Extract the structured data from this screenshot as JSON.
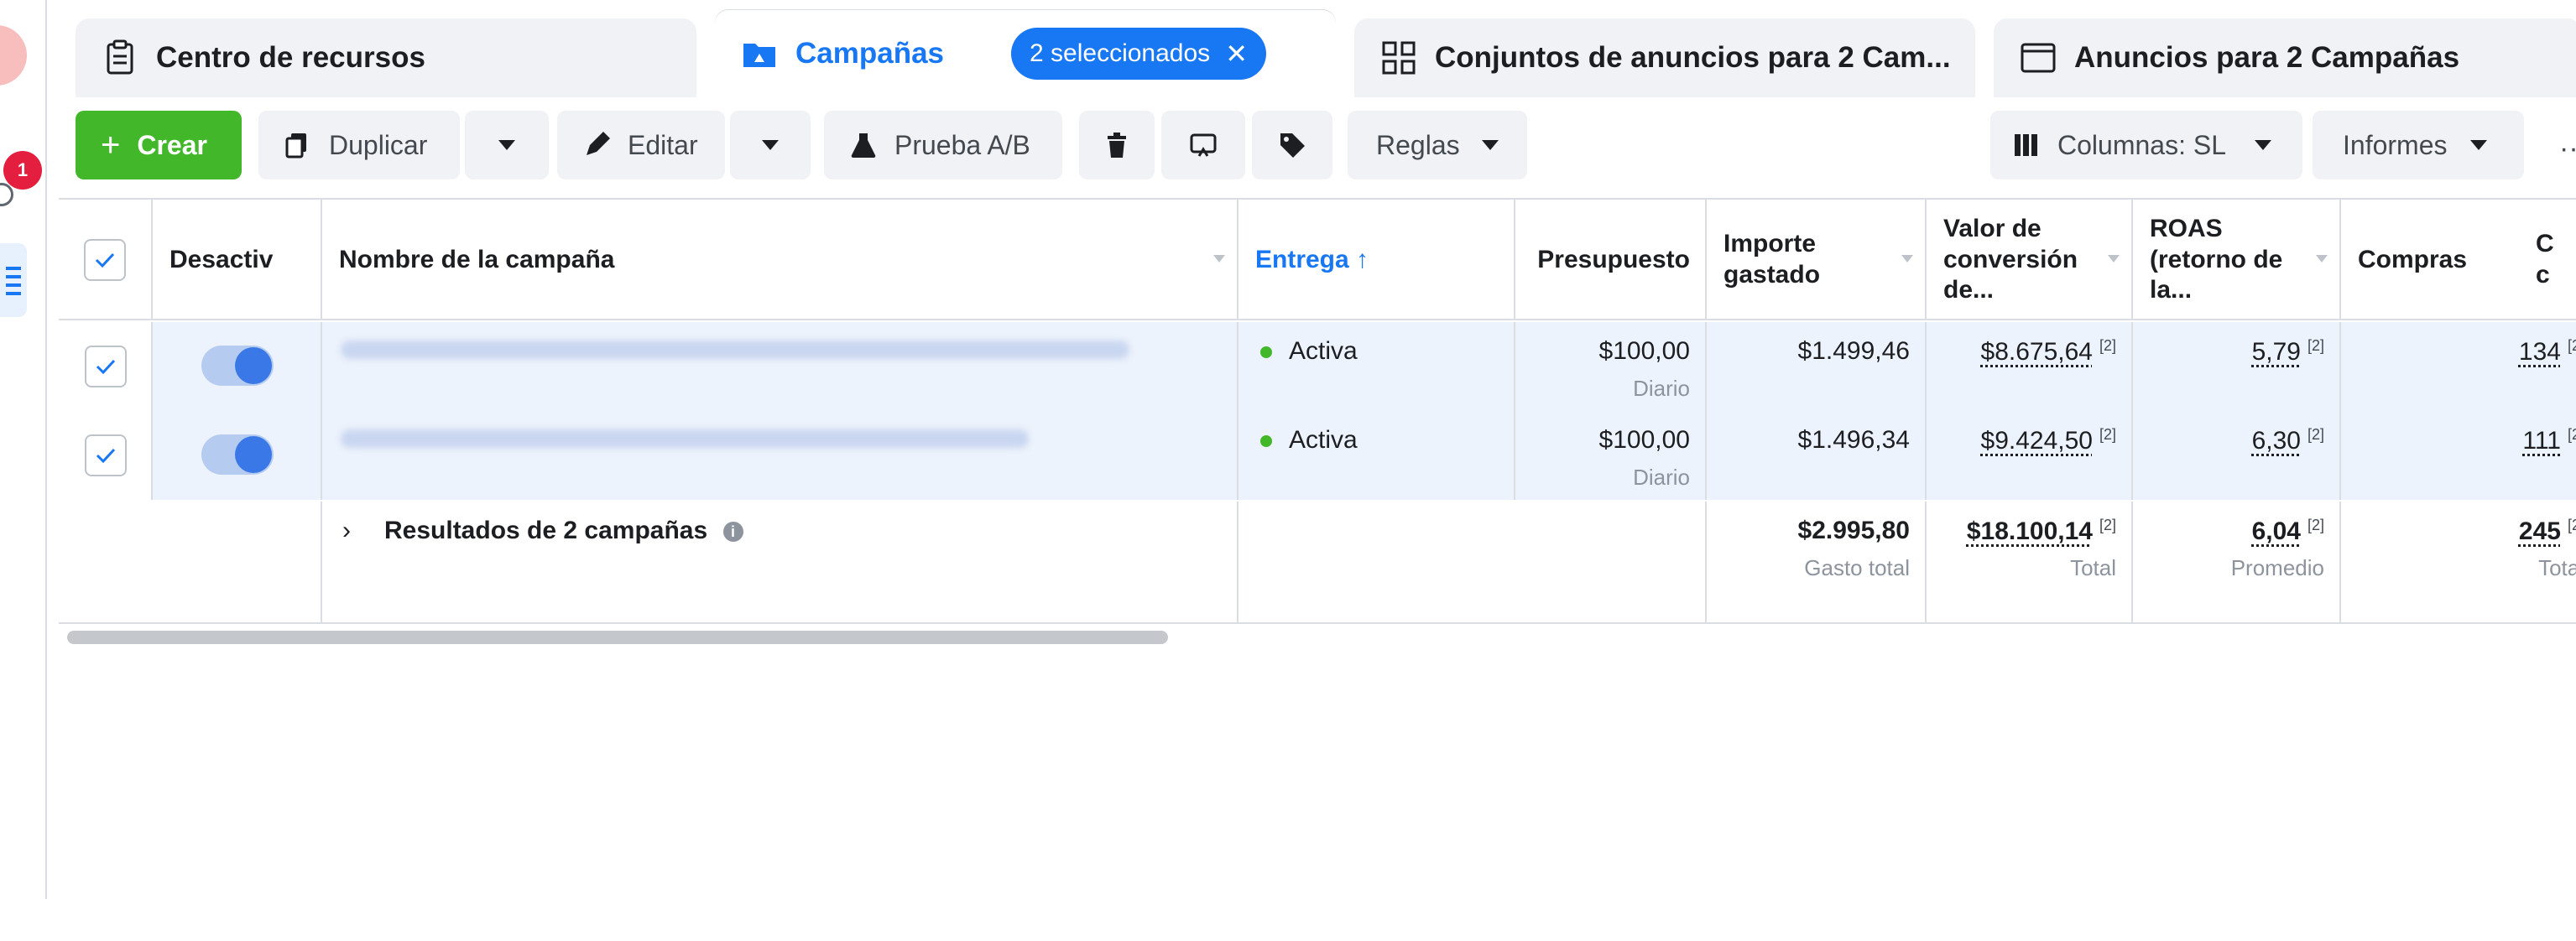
{
  "left_rail": {
    "notification_count": "1"
  },
  "tabs": [
    {
      "label": "Centro de recursos",
      "icon": "clipboard-icon"
    },
    {
      "label": "Campañas",
      "icon": "folder-icon",
      "selected_pill": "2 seleccionados"
    },
    {
      "label": "Conjuntos de anuncios para 2 Cam...",
      "icon": "grid-icon"
    },
    {
      "label": "Anuncios para 2 Campañas",
      "icon": "ad-frame-icon"
    }
  ],
  "toolbar": {
    "create": "Crear",
    "duplicate": "Duplicar",
    "edit": "Editar",
    "ab_test": "Prueba A/B",
    "rules": "Reglas",
    "columns": "Columnas: SL",
    "reports": "Informes"
  },
  "table": {
    "headers": {
      "off": "Desactiv",
      "name": "Nombre de la campaña",
      "delivery": "Entrega ↑",
      "budget": "Presupuesto",
      "spent_1": "Importe",
      "spent_2": "gastado",
      "conv_1": "Valor de",
      "conv_2": "conversión",
      "conv_3": "de...",
      "roas_1": "ROAS",
      "roas_2": "(retorno de",
      "roas_3": "la...",
      "purchases": "Compras",
      "extra_1": "C",
      "extra_2": "c"
    },
    "rows": [
      {
        "delivery": "Activa",
        "budget": "$100,00",
        "budget_sub": "Diario",
        "spent": "$1.499,46",
        "conv": "$8.675,64",
        "roas": "5,79",
        "purchases": "134",
        "footnote": "[2]"
      },
      {
        "delivery": "Activa",
        "budget": "$100,00",
        "budget_sub": "Diario",
        "spent": "$1.496,34",
        "conv": "$9.424,50",
        "roas": "6,30",
        "purchases": "111",
        "footnote": "[2]"
      }
    ],
    "totals": {
      "label": "Resultados de 2 campañas",
      "spent": "$2.995,80",
      "spent_sub": "Gasto total",
      "conv": "$18.100,14",
      "conv_sub": "Total",
      "roas": "6,04",
      "roas_sub": "Promedio",
      "purchases": "245",
      "purchases_sub": "Total",
      "footnote": "[2]"
    }
  },
  "colors": {
    "accent": "#1877f2",
    "create": "#42b72a",
    "selected_row": "#edf3fc",
    "badge": "#e41e3f"
  }
}
